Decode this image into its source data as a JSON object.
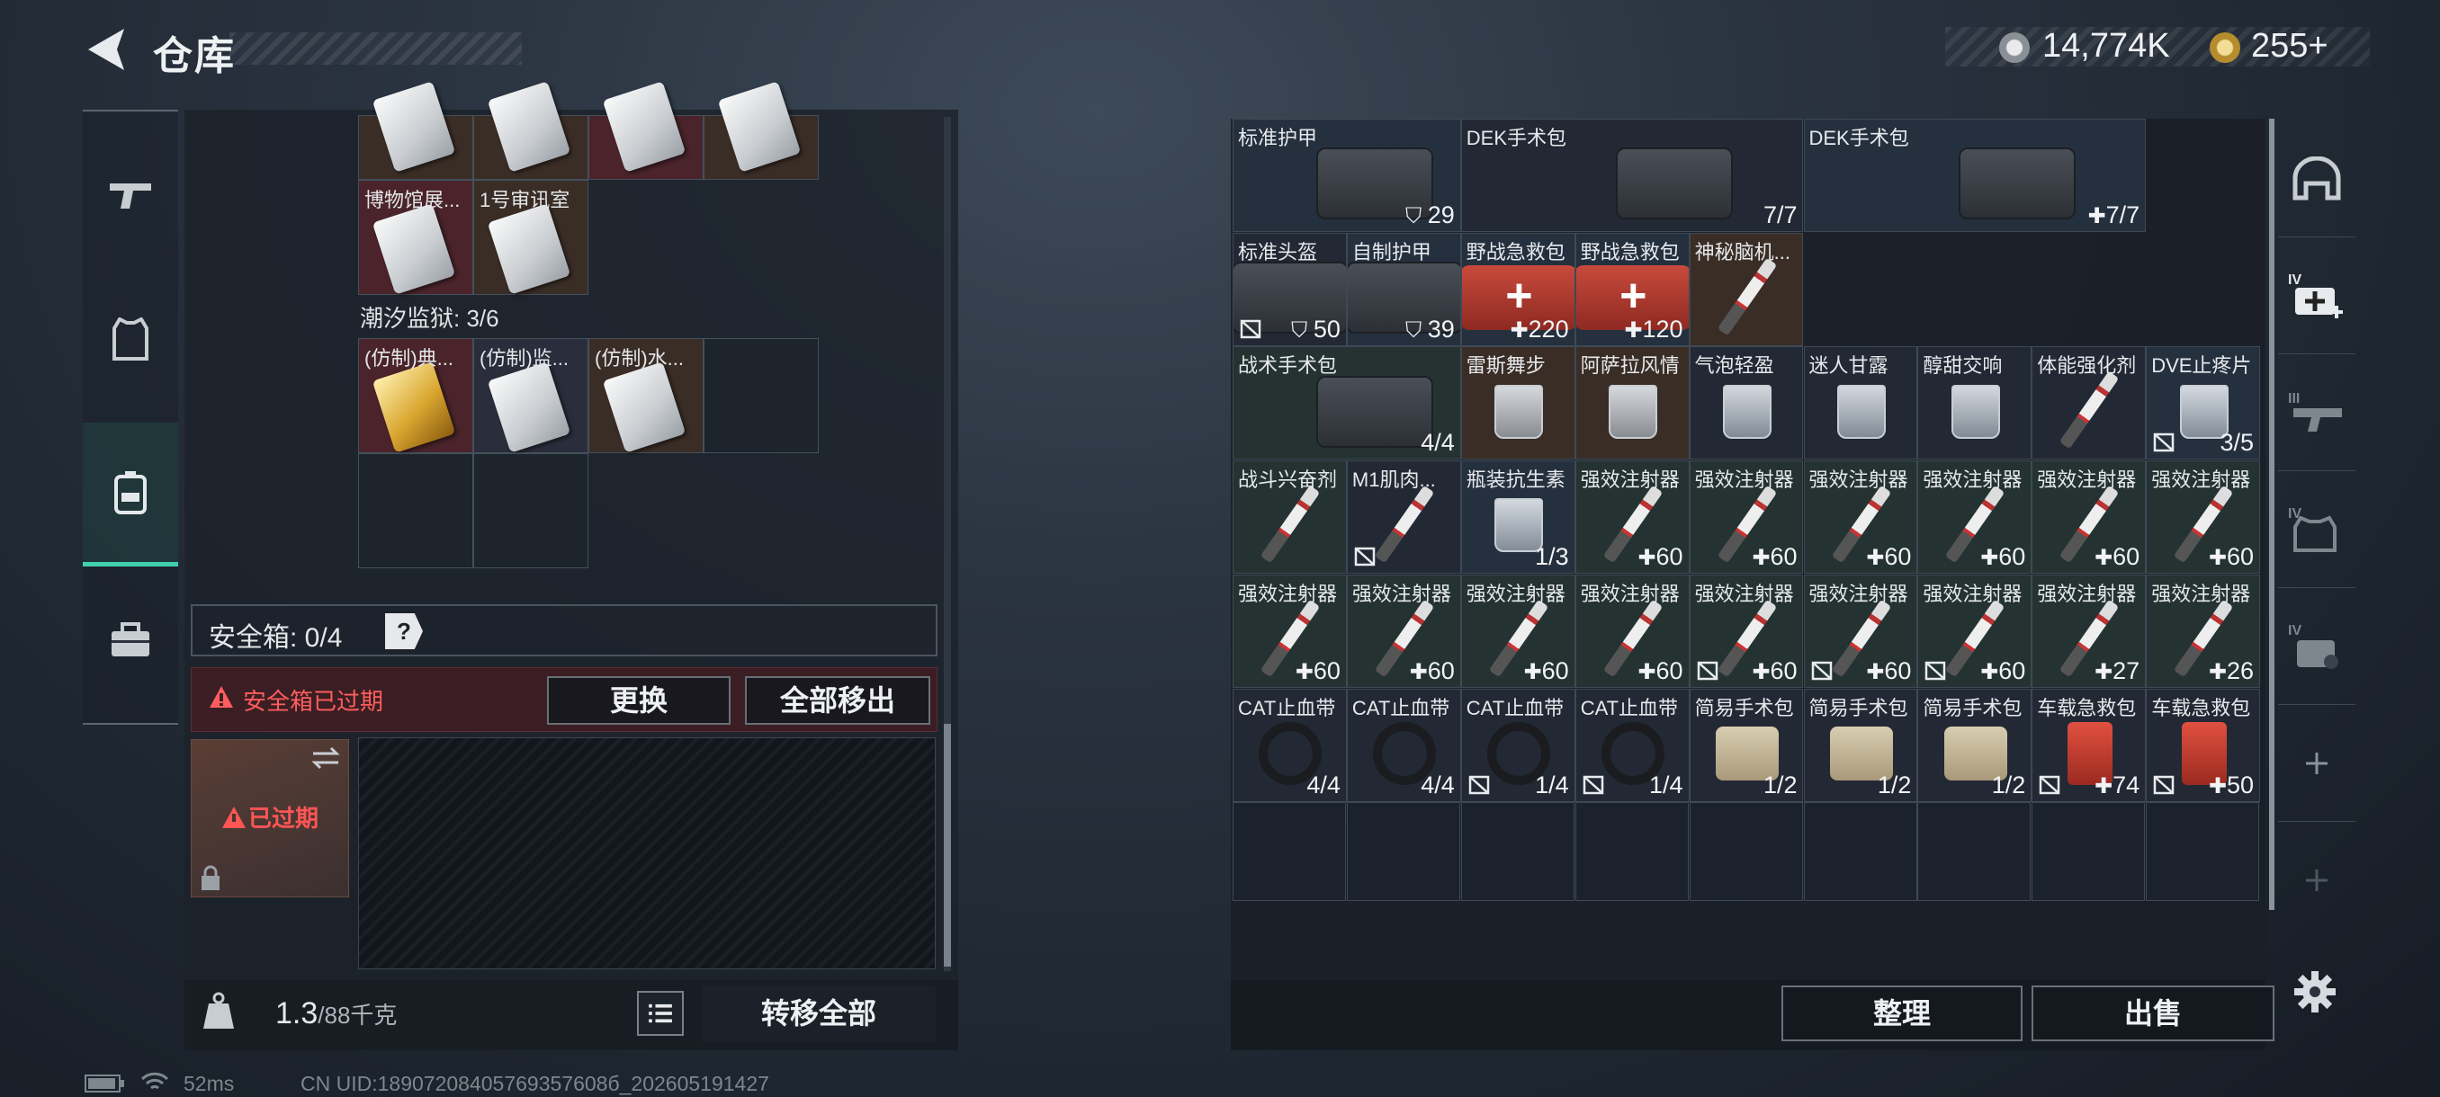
{
  "header": {
    "title": "仓库",
    "currency": [
      {
        "icon": "silver-coin-icon",
        "value": "14,774K"
      },
      {
        "icon": "gold-coin-icon",
        "value": "255+"
      }
    ]
  },
  "sidebar": {
    "items": [
      {
        "icon": "gun-icon"
      },
      {
        "icon": "armor-vest-icon"
      },
      {
        "icon": "backpack-icon",
        "active": true
      },
      {
        "icon": "toolbox-icon"
      }
    ]
  },
  "left": {
    "top_cells": [
      {
        "label": ""
      },
      {
        "label": ""
      },
      {
        "label": ""
      },
      {
        "label": ""
      }
    ],
    "row2": [
      {
        "label": "博物馆展..."
      },
      {
        "label": "1号审讯室"
      }
    ],
    "section_label": "潮汐监狱: 3/6",
    "row3": [
      {
        "label": "(仿制)典..."
      },
      {
        "label": "(仿制)监..."
      },
      {
        "label": "(仿制)水..."
      }
    ],
    "safe_box": {
      "label": "安全箱: 0/4",
      "help": "?",
      "warning": "安全箱已过期",
      "replace": "更换",
      "move_all": "全部移出",
      "slot_status": "已过期"
    },
    "bottom": {
      "weight": "1.3",
      "weight_max": "/88千克",
      "transfer_all": "转移全部"
    }
  },
  "status_bar": {
    "ping": "52ms",
    "uid": "CN UID:18907208405769357608б_202605191427"
  },
  "right": {
    "rows": [
      [
        {
          "name": "标准护甲",
          "count": "29",
          "prefix": "shield"
        },
        {
          "name": "DEK手术包",
          "count": "7/7"
        },
        {
          "name": "DEK手术包",
          "count": "7/7",
          "prefix": "nodrop"
        }
      ],
      [
        {
          "name": "标准头盔",
          "count": "50",
          "prefix": "shield",
          "lock": true
        },
        {
          "name": "自制护甲",
          "count": "39",
          "prefix": "shield"
        },
        {
          "name": "野战急救包",
          "count": "220",
          "prefix": "plus"
        },
        {
          "name": "野战急救包",
          "count": "120",
          "prefix": "plus"
        },
        {
          "name": "神秘脑机...",
          "count": ""
        }
      ],
      [
        {
          "name": "战术手术包",
          "count": "4/4"
        },
        {
          "name": "雷斯舞步",
          "count": ""
        },
        {
          "name": "阿萨拉风情",
          "count": ""
        },
        {
          "name": "气泡轻盈",
          "count": ""
        },
        {
          "name": "迷人甘露",
          "count": ""
        },
        {
          "name": "醇甜交响",
          "count": ""
        },
        {
          "name": "体能强化剂",
          "count": ""
        },
        {
          "name": "DVE止疼片",
          "count": "3/5",
          "lock": true
        }
      ],
      [
        {
          "name": "战斗兴奋剂",
          "count": ""
        },
        {
          "name": "M1肌肉...",
          "count": "",
          "lock": true
        },
        {
          "name": "瓶装抗生素",
          "count": "1/3"
        },
        {
          "name": "强效注射器",
          "count": "60",
          "prefix": "plus"
        },
        {
          "name": "强效注射器",
          "count": "60",
          "prefix": "plus"
        },
        {
          "name": "强效注射器",
          "count": "60",
          "prefix": "plus"
        },
        {
          "name": "强效注射器",
          "count": "60",
          "prefix": "plus"
        },
        {
          "name": "强效注射器",
          "count": "60",
          "prefix": "plus"
        },
        {
          "name": "强效注射器",
          "count": "60",
          "prefix": "plus"
        }
      ],
      [
        {
          "name": "强效注射器",
          "count": "60",
          "prefix": "plus"
        },
        {
          "name": "强效注射器",
          "count": "60",
          "prefix": "plus"
        },
        {
          "name": "强效注射器",
          "count": "60",
          "prefix": "plus"
        },
        {
          "name": "强效注射器",
          "count": "60",
          "prefix": "plus"
        },
        {
          "name": "强效注射器",
          "count": "60",
          "prefix": "plus",
          "lock": true
        },
        {
          "name": "强效注射器",
          "count": "60",
          "prefix": "plus",
          "lock": true
        },
        {
          "name": "强效注射器",
          "count": "60",
          "prefix": "plus",
          "lock": true
        },
        {
          "name": "强效注射器",
          "count": "27",
          "prefix": "plus"
        },
        {
          "name": "强效注射器",
          "count": "26",
          "prefix": "plus"
        }
      ],
      [
        {
          "name": "CAT止血带",
          "count": "4/4"
        },
        {
          "name": "CAT止血带",
          "count": "4/4"
        },
        {
          "name": "CAT止血带",
          "count": "1/4",
          "lock": true
        },
        {
          "name": "CAT止血带",
          "count": "1/4",
          "lock": true
        },
        {
          "name": "简易手术包",
          "count": "1/2"
        },
        {
          "name": "简易手术包",
          "count": "1/2"
        },
        {
          "name": "简易手术包",
          "count": "1/2"
        },
        {
          "name": "车载急救包",
          "count": "74",
          "prefix": "plus",
          "lock": true
        },
        {
          "name": "车载急救包",
          "count": "50",
          "prefix": "plus",
          "lock": true
        }
      ]
    ],
    "bottom": {
      "organize": "整理",
      "sell": "出售"
    }
  },
  "right_tabs": [
    {
      "icon": "helmet-icon"
    },
    {
      "icon": "medkit-iv-icon"
    },
    {
      "icon": "gun-iii-icon"
    },
    {
      "icon": "armor-iv-icon"
    },
    {
      "icon": "backpack-iv-icon"
    },
    {
      "icon": "add-icon"
    },
    {
      "icon": "add-icon"
    }
  ]
}
